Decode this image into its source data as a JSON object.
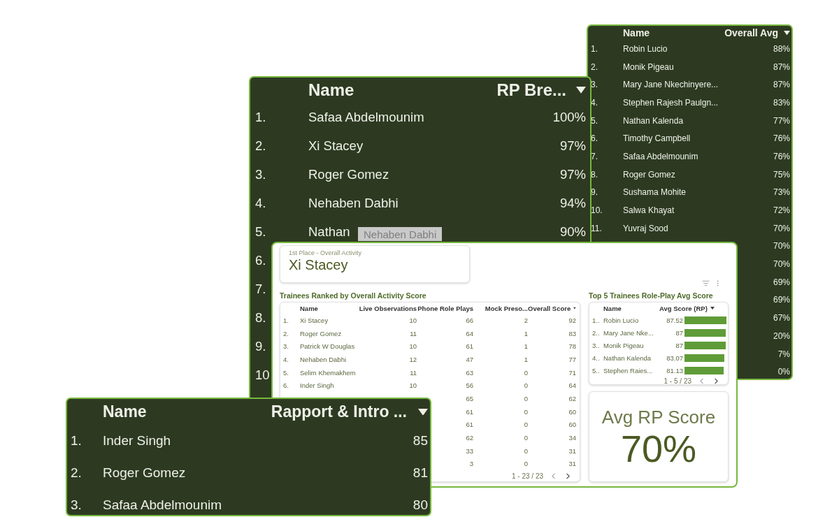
{
  "overall_avg_panel": {
    "columns": [
      "Name",
      "Overall Avg"
    ],
    "rows": [
      {
        "rank": "1.",
        "name": "Robin Lucio",
        "value": "88%"
      },
      {
        "rank": "2.",
        "name": "Monik Pigeau",
        "value": "87%"
      },
      {
        "rank": "3.",
        "name": "Mary Jane Nkechinyere...",
        "value": "87%"
      },
      {
        "rank": "4.",
        "name": "Stephen Rajesh Paulgn...",
        "value": "83%"
      },
      {
        "rank": "5.",
        "name": "Nathan Kalenda",
        "value": "77%"
      },
      {
        "rank": "6.",
        "name": "Timothy Campbell",
        "value": "76%"
      },
      {
        "rank": "7.",
        "name": "Safaa Abdelmounim",
        "value": "76%"
      },
      {
        "rank": "8.",
        "name": "Roger Gomez",
        "value": "75%"
      },
      {
        "rank": "9.",
        "name": "Sushama Mohite",
        "value": "73%"
      },
      {
        "rank": "10.",
        "name": "Salwa Khayat",
        "value": "72%"
      },
      {
        "rank": "11.",
        "name": "Yuvraj Sood",
        "value": "70%"
      },
      {
        "value": "70%"
      },
      {
        "value": "70%"
      },
      {
        "value": "69%"
      },
      {
        "value": "69%"
      },
      {
        "value": "67%"
      },
      {
        "value": "20%"
      },
      {
        "value": "7%"
      },
      {
        "value": "0%"
      }
    ]
  },
  "rp_breakdown_panel": {
    "columns": [
      "Name",
      "RP Bre..."
    ],
    "rows": [
      {
        "rank": "1.",
        "name": "Safaa Abdelmounim",
        "value": "100%"
      },
      {
        "rank": "2.",
        "name": "Xi Stacey",
        "value": "97%"
      },
      {
        "rank": "3.",
        "name": "Roger Gomez",
        "value": "97%"
      },
      {
        "rank": "4.",
        "name": "Nehaben Dabhi",
        "value": "94%"
      },
      {
        "rank": "5.",
        "name": "Nathan",
        "value": "90%"
      },
      {
        "rank": "6."
      },
      {
        "rank": "7."
      },
      {
        "rank": "8."
      },
      {
        "rank": "9."
      },
      {
        "rank": "10"
      }
    ],
    "tooltip": "Nehaben Dabhi"
  },
  "dashboard": {
    "first_place": {
      "label": "1st Place - Overall Activity",
      "name": "Xi Stacey"
    },
    "activity_table": {
      "title": "Trainees Ranked by Overall Activity Score",
      "columns": [
        "Name",
        "Live Observations",
        "Phone Role Plays",
        "Mock Preso...",
        "Overall Score"
      ],
      "rows": [
        {
          "rank": "1.",
          "name": "Xi Stacey",
          "live": "10",
          "phone": "66",
          "mock": "2",
          "overall": "92"
        },
        {
          "rank": "2.",
          "name": "Roger Gomez",
          "live": "11",
          "phone": "64",
          "mock": "1",
          "overall": "83"
        },
        {
          "rank": "3.",
          "name": "Patrick W Douglas",
          "live": "10",
          "phone": "61",
          "mock": "1",
          "overall": "78"
        },
        {
          "rank": "4.",
          "name": "Nehaben Dabhi",
          "live": "12",
          "phone": "47",
          "mock": "1",
          "overall": "77"
        },
        {
          "rank": "5.",
          "name": "Selim Khemakhem",
          "live": "11",
          "phone": "63",
          "mock": "0",
          "overall": "71"
        },
        {
          "rank": "6.",
          "name": "Inder Singh",
          "live": "10",
          "phone": "56",
          "mock": "0",
          "overall": "64"
        },
        {
          "phone": "65",
          "mock": "0",
          "overall": "62"
        },
        {
          "phone": "61",
          "mock": "0",
          "overall": "60"
        },
        {
          "phone": "61",
          "mock": "0",
          "overall": "60"
        },
        {
          "phone": "62",
          "mock": "0",
          "overall": "34"
        },
        {
          "phone": "33",
          "mock": "0",
          "overall": "31"
        },
        {
          "phone": "3",
          "mock": "0",
          "overall": "31"
        }
      ],
      "pagination": "1 - 23 / 23"
    },
    "top5_table": {
      "title": "Top 5 Trainees Role-Play Avg Score",
      "columns": [
        "Name",
        "Avg Score (RP)"
      ],
      "rows": [
        {
          "rank": "1..",
          "name": "Robin Lucio",
          "value": "87.52",
          "level": 1
        },
        {
          "rank": "2..",
          "name": "Mary Jane Nke...",
          "value": "87",
          "level": 0.99
        },
        {
          "rank": "3..",
          "name": "Monik Pigeau",
          "value": "87",
          "level": 0.99
        },
        {
          "rank": "4..",
          "name": "Nathan Kalenda",
          "value": "83.07",
          "level": 0.95
        },
        {
          "rank": "5..",
          "name": "Stephen Raies...",
          "value": "81.13",
          "level": 0.93
        }
      ],
      "pagination": "1 - 5 / 23"
    },
    "kpi": {
      "label": "Avg RP Score",
      "value": "70%"
    }
  },
  "rapport_panel": {
    "columns": [
      "Name",
      "Rapport & Intro ..."
    ],
    "rows": [
      {
        "rank": "1.",
        "name": "Inder Singh",
        "value": "85"
      },
      {
        "rank": "2.",
        "name": "Roger Gomez",
        "value": "81"
      },
      {
        "rank": "3.",
        "name": "Safaa Abdelmounim",
        "value": "80"
      }
    ]
  }
}
